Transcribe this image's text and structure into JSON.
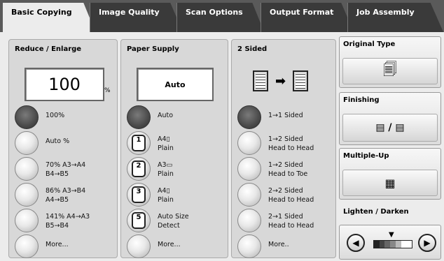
{
  "tabs": [
    {
      "label": "Basic Copying"
    },
    {
      "label": "Image Quality"
    },
    {
      "label": "Scan Options"
    },
    {
      "label": "Output Format"
    },
    {
      "label": "Job Assembly"
    }
  ],
  "reduce_enlarge": {
    "title": "Reduce / Enlarge",
    "value": "100",
    "unit": "%",
    "options": [
      {
        "line1": "100%",
        "line2": "",
        "selected": true
      },
      {
        "line1": "Auto %",
        "line2": "",
        "selected": false
      },
      {
        "line1": "70% A3→A4",
        "line2": "B4→B5",
        "selected": false
      },
      {
        "line1": "86% A3→B4",
        "line2": "A4→B5",
        "selected": false
      },
      {
        "line1": "141% A4→A3",
        "line2": "B5→B4",
        "selected": false
      },
      {
        "line1": "More...",
        "line2": "",
        "selected": false
      }
    ]
  },
  "paper_supply": {
    "title": "Paper Supply",
    "value": "Auto",
    "options": [
      {
        "tray": "",
        "line1": "Auto",
        "line2": "",
        "selected": true
      },
      {
        "tray": "1",
        "line1": "A4▯",
        "line2": "Plain",
        "selected": false
      },
      {
        "tray": "2",
        "line1": "A3▭",
        "line2": "Plain",
        "selected": false
      },
      {
        "tray": "3",
        "line1": "A4▯",
        "line2": "Plain",
        "selected": false
      },
      {
        "tray": "5",
        "line1": "Auto Size",
        "line2": "Detect",
        "selected": false
      },
      {
        "tray": "",
        "line1": "More...",
        "line2": "",
        "selected": false
      }
    ]
  },
  "two_sided": {
    "title": "2 Sided",
    "options": [
      {
        "line1": "1→1 Sided",
        "line2": "",
        "selected": true
      },
      {
        "line1": "1→2 Sided",
        "line2": "Head to Head",
        "selected": false
      },
      {
        "line1": "1→2 Sided",
        "line2": "Head to Toe",
        "selected": false
      },
      {
        "line1": "2→2 Sided",
        "line2": "Head to Head",
        "selected": false
      },
      {
        "line1": "2→1 Sided",
        "line2": "Head to Head",
        "selected": false
      },
      {
        "line1": "More..",
        "line2": "",
        "selected": false
      }
    ]
  },
  "right": {
    "original_type": "Original Type",
    "finishing": "Finishing",
    "multiple_up": "Multiple-Up",
    "lighten_darken": "Lighten / Darken",
    "lighten_level": 0.5
  },
  "colors": {
    "selected_radio": "#4a4a4a",
    "tab_inactive": "#3a3a3a"
  }
}
